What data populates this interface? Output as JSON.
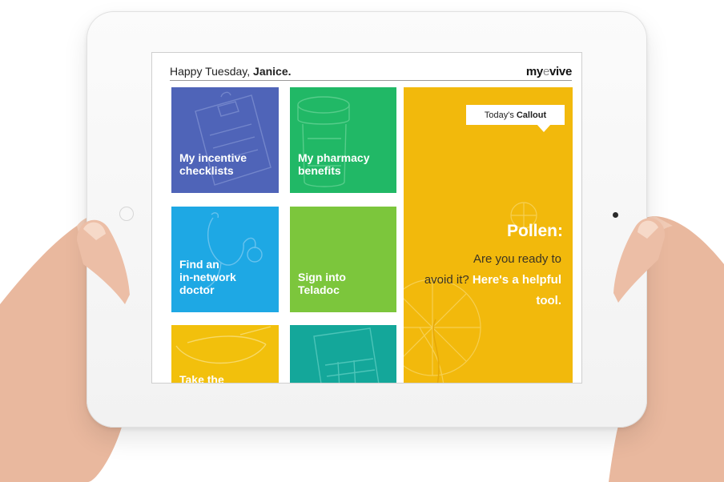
{
  "header": {
    "greeting": "Happy Tuesday,",
    "name": "Janice.",
    "logo_my": "my",
    "logo_e": "e",
    "logo_vive": "vive"
  },
  "tiles": [
    {
      "label": "My incentive\nchecklists",
      "color": "#4f64b8",
      "icon": "clipboard-icon"
    },
    {
      "label": "My pharmacy\nbenefits",
      "color": "#21b866",
      "icon": "pill-bottle-icon"
    },
    {
      "label": "Find an\nin-network\ndoctor",
      "color": "#1ea8e4",
      "icon": "stethoscope-icon"
    },
    {
      "label": "Sign into\nTeladoc",
      "color": "#7cc63c",
      "icon": ""
    },
    {
      "label": "Take the",
      "color": "#f2c00c",
      "icon": "bowl-icon"
    },
    {
      "label": "",
      "color": "#14a79a",
      "icon": "calculator-icon"
    }
  ],
  "callout": {
    "tag_prefix": "Today's",
    "tag_bold": "Callout",
    "title": "Pollen:",
    "body_line1": "Are you ready to",
    "body_line2": "avoid it?",
    "link_text": "Here's a helpful tool.",
    "color": "#f2b90c",
    "icon": "dandelion-icon"
  }
}
